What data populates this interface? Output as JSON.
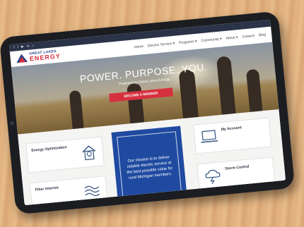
{
  "social_icons": [
    "facebook-icon",
    "twitter-icon",
    "youtube-icon",
    "linkedin-icon",
    "search-icon"
  ],
  "top_links": [
    "",
    "",
    "",
    ""
  ],
  "logo": {
    "line1": "GREAT LAKES",
    "line2": "ENERGY"
  },
  "nav": [
    "Home",
    "Electric Service ▾",
    "Programs ▾",
    "Community ▾",
    "About ▾",
    "Careers",
    "Blog"
  ],
  "hero": {
    "title": "POWER. PURPOSE. YOU.",
    "subtitle": "Powered by Great Lakes Energy",
    "button": "BECOME A MEMBER"
  },
  "cards": {
    "energy": {
      "title": "Energy Optimization",
      "desc": ""
    },
    "fiber": {
      "title": "Fiber Internet",
      "desc": ""
    },
    "account": {
      "title": "My Account",
      "desc": ""
    },
    "storm": {
      "title": "Storm Central",
      "desc": ""
    }
  },
  "mission": "Our mission is to deliver reliable electric service at the best possible value for rural Michigan members.",
  "colors": {
    "brand_blue": "#1f4aa0",
    "brand_red": "#d6303f",
    "topbar": "#2b3348"
  }
}
